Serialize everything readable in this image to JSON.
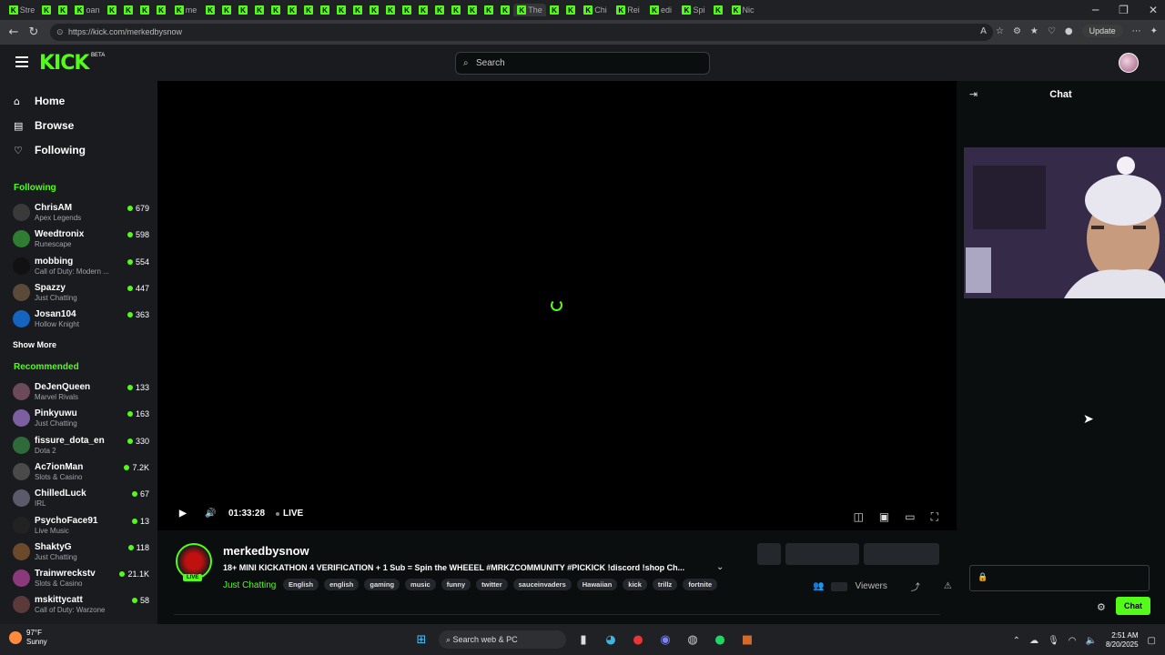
{
  "browser": {
    "url": "https://kick.com/merkedbysnow",
    "tabs": [
      "Stre",
      "",
      "",
      "oan",
      "",
      "",
      "",
      "",
      "me",
      "",
      "",
      "",
      "",
      "",
      "",
      "",
      "",
      "",
      "",
      "",
      "",
      "",
      "",
      "",
      "",
      "",
      "",
      "",
      "The",
      "",
      "",
      "Chi",
      "Rei",
      "edi",
      "Spi",
      "",
      "Nic"
    ],
    "update_label": "Update"
  },
  "header": {
    "logo": "KICK",
    "logo_badge": "BETA",
    "search_placeholder": "Search"
  },
  "sidebar": {
    "nav": [
      {
        "label": "Home",
        "icon": "home-icon"
      },
      {
        "label": "Browse",
        "icon": "browse-icon"
      },
      {
        "label": "Following",
        "icon": "heart-icon"
      }
    ],
    "following_title": "Following",
    "following": [
      {
        "name": "ChrisAM",
        "game": "Apex Legends",
        "viewers": "679",
        "color": "#3a3a3a"
      },
      {
        "name": "Weedtronix",
        "game": "Runescape",
        "viewers": "598",
        "color": "#2e7d32"
      },
      {
        "name": "mobbing",
        "game": "Call of Duty: Modern ...",
        "viewers": "554",
        "color": "#111111"
      },
      {
        "name": "Spazzy",
        "game": "Just Chatting",
        "viewers": "447",
        "color": "#5a4a3a"
      },
      {
        "name": "Josan104",
        "game": "Hollow Knight",
        "viewers": "363",
        "color": "#1565c0"
      }
    ],
    "show_more": "Show More",
    "recommended_title": "Recommended",
    "recommended": [
      {
        "name": "DeJenQueen",
        "game": "Marvel Rivals",
        "viewers": "133",
        "color": "#6b4a5a"
      },
      {
        "name": "Pinkyuwu",
        "game": "Just Chatting",
        "viewers": "163",
        "color": "#7b5fa0"
      },
      {
        "name": "fissure_dota_en",
        "game": "Dota 2",
        "viewers": "330",
        "color": "#2f6b3a"
      },
      {
        "name": "Ac7ionMan",
        "game": "Slots & Casino",
        "viewers": "7.2K",
        "color": "#4a4a4a"
      },
      {
        "name": "ChilledLuck",
        "game": "IRL",
        "viewers": "67",
        "color": "#5a5a6a"
      },
      {
        "name": "PsychoFace91",
        "game": "Live Music",
        "viewers": "13",
        "color": "#222222"
      },
      {
        "name": "ShaktyG",
        "game": "Just Chatting",
        "viewers": "118",
        "color": "#6a4a2a"
      },
      {
        "name": "Trainwreckstv",
        "game": "Slots & Casino",
        "viewers": "21.1K",
        "color": "#8a3a7a"
      },
      {
        "name": "mskittycatt",
        "game": "Call of Duty: Warzone",
        "viewers": "58",
        "color": "#5a3a3a"
      }
    ]
  },
  "player": {
    "time": "01:33:28",
    "live_label": "LIVE"
  },
  "stream": {
    "name": "merkedbysnow",
    "live_badge": "LIVE",
    "title": "18+ MINI KICKATHON 4 VERIFICATION + 1 Sub = Spin the WHEEEL #MRKZCOMMUNITY #PICKICK !discord !shop Ch...",
    "category": "Just Chatting",
    "tags": [
      "English",
      "english",
      "gaming",
      "music",
      "funny",
      "twitter",
      "sauceinvaders",
      "Hawaiian",
      "kick",
      "trillz",
      "fortnite"
    ],
    "viewers_label": "Viewers"
  },
  "chat": {
    "title": "Chat",
    "send_label": "Chat"
  },
  "taskbar": {
    "temp": "97°F",
    "weather": "Sunny",
    "search_placeholder": "Search web & PC",
    "time": "2:51 AM",
    "date": "8/20/2025"
  },
  "colors": {
    "accent": "#53fc18",
    "background": "#0b0e0f",
    "panel": "#191b1f"
  }
}
